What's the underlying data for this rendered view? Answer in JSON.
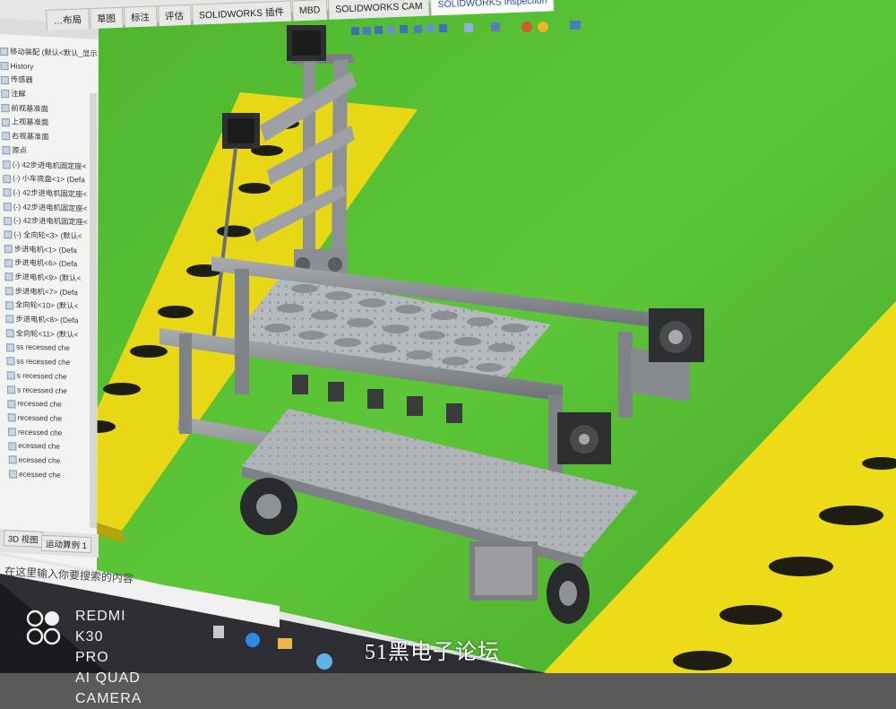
{
  "app": {
    "tabs": [
      {
        "label": "…布局"
      },
      {
        "label": "草图"
      },
      {
        "label": "标注"
      },
      {
        "label": "评估"
      },
      {
        "label": "SOLIDWORKS 插件"
      },
      {
        "label": "MBD"
      },
      {
        "label": "SOLIDWORKS CAM"
      },
      {
        "label": "SOLIDWORKS Inspection"
      }
    ],
    "active_tab": "SOLIDWORKS Inspection"
  },
  "feature_tree": {
    "items": [
      {
        "label": "移动装配 (默认<默认_显示"
      },
      {
        "label": "History"
      },
      {
        "label": "传感器"
      },
      {
        "label": "注解"
      },
      {
        "label": "前视基准面"
      },
      {
        "label": "上视基准面"
      },
      {
        "label": "右视基准面"
      },
      {
        "label": "原点"
      },
      {
        "label": "(-) 42步进电机固定座<"
      },
      {
        "label": "(-) 小车底盘<1> (Defa"
      },
      {
        "label": "(-) 42步进电机固定座<"
      },
      {
        "label": "(-) 42步进电机固定座<"
      },
      {
        "label": "(-) 42步进电机固定座<"
      },
      {
        "label": "(-) 全向轮<3> (默认<"
      },
      {
        "label": "步进电机<1> (Defa"
      },
      {
        "label": "步进电机<6> (Defa"
      },
      {
        "label": "步进电机<9> (默认<"
      },
      {
        "label": "步进电机<7> (Defa"
      },
      {
        "label": "全向轮<10> (默认<"
      },
      {
        "label": "步进电机<8> (Defa"
      },
      {
        "label": "全向轮<11> (默认<"
      },
      {
        "label": "ss recessed che"
      },
      {
        "label": "ss recessed che"
      },
      {
        "label": "s recessed che"
      },
      {
        "label": "s recessed che"
      },
      {
        "label": "recessed che"
      },
      {
        "label": "recessed che"
      },
      {
        "label": "recessed che"
      },
      {
        "label": "ecessed che"
      },
      {
        "label": "ecessed che"
      },
      {
        "label": "ecessed che"
      }
    ]
  },
  "bottom_tabs": {
    "view3d": "3D 视图",
    "motion": "运动算例 1"
  },
  "taskbar": {
    "search_placeholder": "在这里输入你要搜索的内容"
  },
  "watermark": {
    "device": "REDMI K30 PRO",
    "camera": "AI QUAD CAMERA",
    "forum": "51黑电子论坛"
  },
  "colors": {
    "viewport_green": "#55c034",
    "board_yellow": "#ecdb16",
    "frame_gray": "#8c8f94"
  }
}
